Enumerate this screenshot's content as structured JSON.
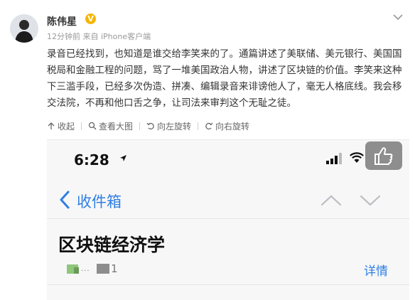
{
  "post": {
    "author_name": "陈伟星",
    "verified_badge": "V",
    "meta": "12分钟前 来自 iPhone客户端",
    "body": "录音已经找到，也知道是谁交给李笑来的了。通篇讲述了美联储、美元银行、美国国税局和金融工程的问题，骂了一堆美国政治人物，讲述了区块链的价值。李笑来这种下三滥手段，已经多次伪造、拼凑、编辑录音来诽谤他人了，毫无人格底线。我会移交法院，不再和他口舌之争，让司法来审判这个无耻之徒。",
    "actions": {
      "collapse": "收起",
      "view_large": "查看大图",
      "rotate_left": "向左旋转",
      "rotate_right": "向右旋转"
    },
    "icons": {
      "more": "chevron-down-icon",
      "collapse": "collapse-icon",
      "view_large": "magnifier-icon",
      "rotate_left": "rotate-left-icon",
      "rotate_right": "rotate-right-icon"
    },
    "colors": {
      "verified": "#f5b500",
      "link_blue": "#2f7fe3"
    }
  },
  "screenshot": {
    "status_time": "6:28",
    "back_label": "收件箱",
    "subject": "区块链经济学",
    "sender_ellipsis": "...",
    "attachment_count": "1",
    "detail_label": "详情",
    "icons": {
      "location": "location-arrow-icon",
      "signal": "signal-bars-icon",
      "wifi": "wifi-icon",
      "thumbs_up": "thumbs-up-icon",
      "back": "chevron-left-icon",
      "prev": "chevron-up-icon",
      "next": "chevron-down-icon"
    }
  }
}
